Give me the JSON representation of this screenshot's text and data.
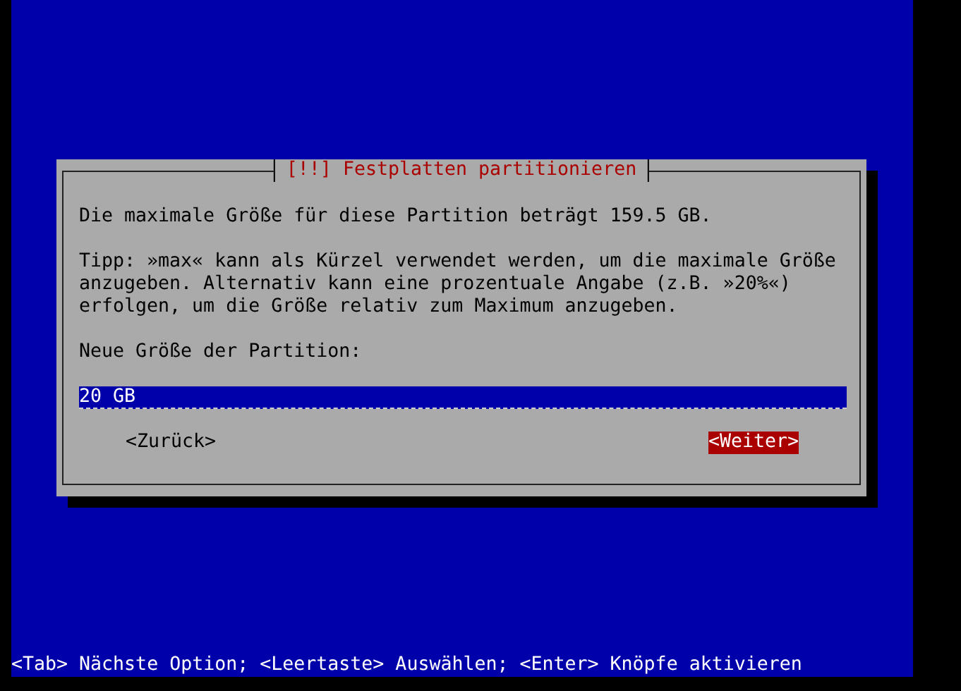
{
  "dialog": {
    "title": "[!!] Festplatten partitionieren",
    "paragraphs": [
      "Die maximale Größe für diese Partition beträgt 159.5 GB.",
      "Tipp: »max« kann als Kürzel verwendet werden, um die maximale Größe anzugeben. Alternativ kann eine prozentuale Angabe (z.B. »20%«) erfolgen, um die Größe relativ zum Maximum anzugeben."
    ],
    "field_label": "Neue Größe der Partition:",
    "field": {
      "value": "20 GB"
    },
    "buttons": [
      {
        "label": "<Zurück>",
        "selected": false
      },
      {
        "label": "<Weiter>",
        "selected": true
      }
    ]
  },
  "status_bar": "<Tab> Nächste Option; <Leertaste> Auswählen; <Enter> Knöpfe aktivieren"
}
